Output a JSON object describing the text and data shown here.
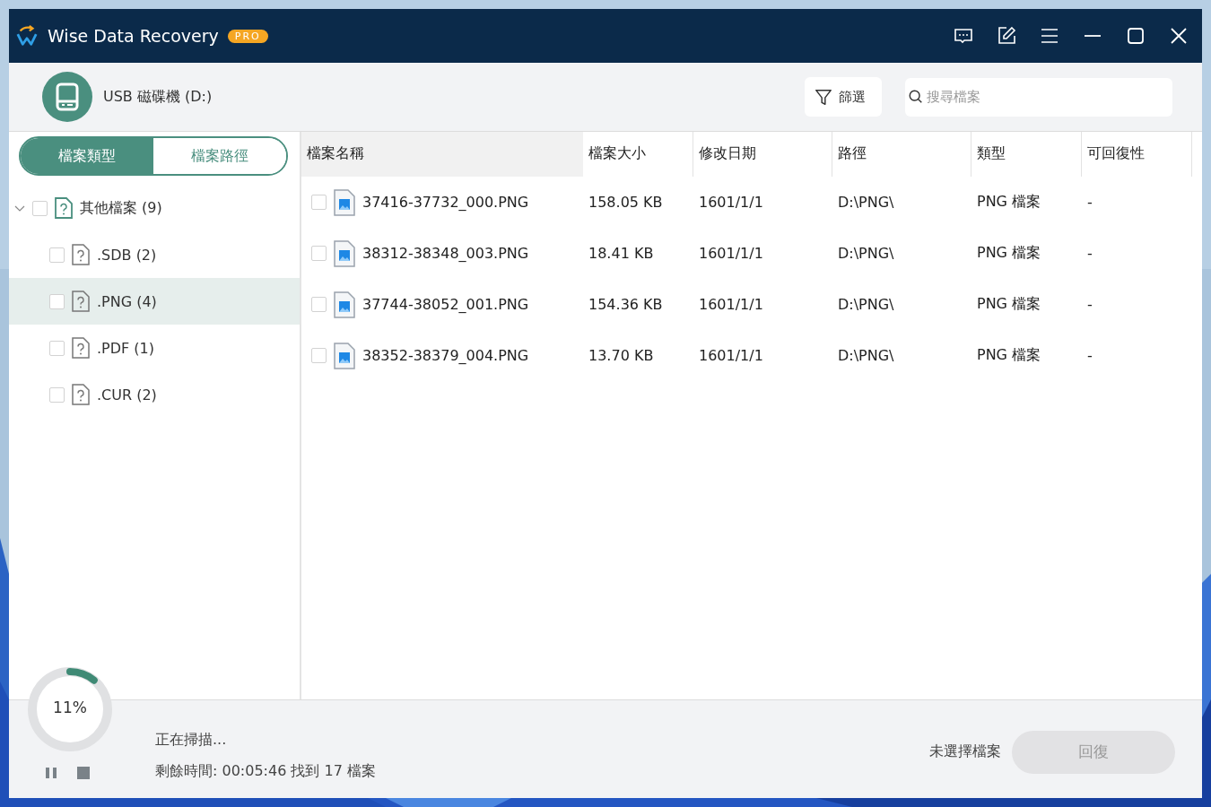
{
  "window": {
    "title": "Wise Data Recovery",
    "badge": "PRO"
  },
  "drive": {
    "label": "USB 磁碟機 (D:)"
  },
  "filter_button": "篩選",
  "search": {
    "placeholder": "搜尋檔案"
  },
  "tabs": [
    {
      "label": "檔案類型",
      "selected": true
    },
    {
      "label": "檔案路徑",
      "selected": false
    }
  ],
  "tree": [
    {
      "label": "其他檔案 (9)",
      "checked": false,
      "expanded": true,
      "selected": false,
      "children": [
        {
          "label": ".SDB (2)",
          "checked": false,
          "selected": false
        },
        {
          "label": ".PNG (4)",
          "checked": false,
          "selected": true
        },
        {
          "label": ".PDF (1)",
          "checked": false,
          "selected": false
        },
        {
          "label": ".CUR (2)",
          "checked": false,
          "selected": false
        }
      ]
    }
  ],
  "table": {
    "columns": [
      {
        "label": "檔案名稱",
        "sorted": true
      },
      {
        "label": "檔案大小",
        "sorted": false
      },
      {
        "label": "修改日期",
        "sorted": false
      },
      {
        "label": "路徑",
        "sorted": false
      },
      {
        "label": "類型",
        "sorted": false
      },
      {
        "label": "可回復性",
        "sorted": false
      }
    ],
    "rows": [
      {
        "checked": false,
        "cells": [
          "37416-37732_000.PNG",
          "158.05 KB",
          "1601/1/1",
          "D:\\PNG\\",
          "PNG 檔案",
          "-"
        ]
      },
      {
        "checked": false,
        "cells": [
          "38312-38348_003.PNG",
          "18.41 KB",
          "1601/1/1",
          "D:\\PNG\\",
          "PNG 檔案",
          "-"
        ]
      },
      {
        "checked": false,
        "cells": [
          "37744-38052_001.PNG",
          "154.36 KB",
          "1601/1/1",
          "D:\\PNG\\",
          "PNG 檔案",
          "-"
        ]
      },
      {
        "checked": false,
        "cells": [
          "38352-38379_004.PNG",
          "13.70 KB",
          "1601/1/1",
          "D:\\PNG\\",
          "PNG 檔案",
          "-"
        ]
      }
    ]
  },
  "scan": {
    "level": 0.11,
    "percent": "11%",
    "status": "正在掃描...",
    "detail": "剩餘時間: 00:05:46 找到 17 檔案"
  },
  "selection_text": "未選擇檔案",
  "recover_button": {
    "label": "回復",
    "disabled": true
  }
}
